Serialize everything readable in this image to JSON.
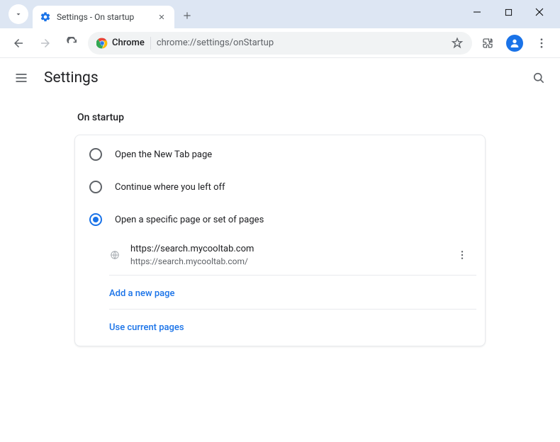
{
  "window": {
    "tab_title": "Settings - On startup"
  },
  "toolbar": {
    "chip_label": "Chrome",
    "url": "chrome://settings/onStartup"
  },
  "page": {
    "title": "Settings",
    "section_title": "On startup",
    "options": {
      "new_tab": "Open the New Tab page",
      "continue": "Continue where you left off",
      "specific": "Open a specific page or set of pages"
    },
    "startup_page": {
      "name": "https://search.mycooltab.com",
      "url": "https://search.mycooltab.com/"
    },
    "links": {
      "add_page": "Add a new page",
      "use_current": "Use current pages"
    }
  }
}
